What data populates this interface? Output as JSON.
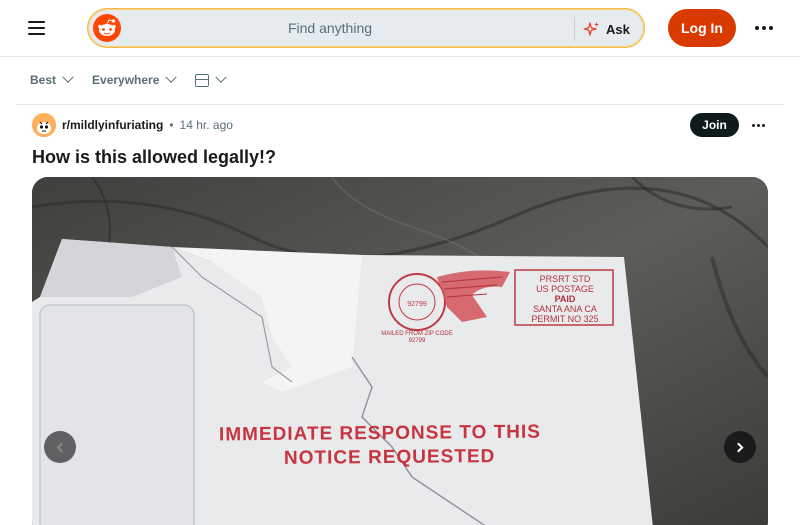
{
  "header": {
    "search_placeholder": "Find anything",
    "ask_label": "Ask",
    "login_label": "Log In",
    "accent_color": "#d93a00"
  },
  "filters": {
    "sort_label": "Best",
    "location_label": "Everywhere",
    "view_icon": "card-view-icon"
  },
  "post": {
    "subreddit": "r/mildlyinfuriating",
    "separator": "•",
    "time_ago": "14 hr. ago",
    "join_label": "Join",
    "title": "How is this allowed legally!?"
  },
  "image": {
    "stamp_permit": {
      "line1": "PRSRT STD",
      "line2": "US POSTAGE",
      "line3": "PAID",
      "line4": "SANTA ANA CA",
      "line5": "PERMIT NO 325"
    },
    "stamp_circle": "MAILED FROM ZIP CODE 92799",
    "notice_line1": "IMMEDIATE RESPONSE TO THIS",
    "notice_line2": "NOTICE REQUESTED"
  }
}
